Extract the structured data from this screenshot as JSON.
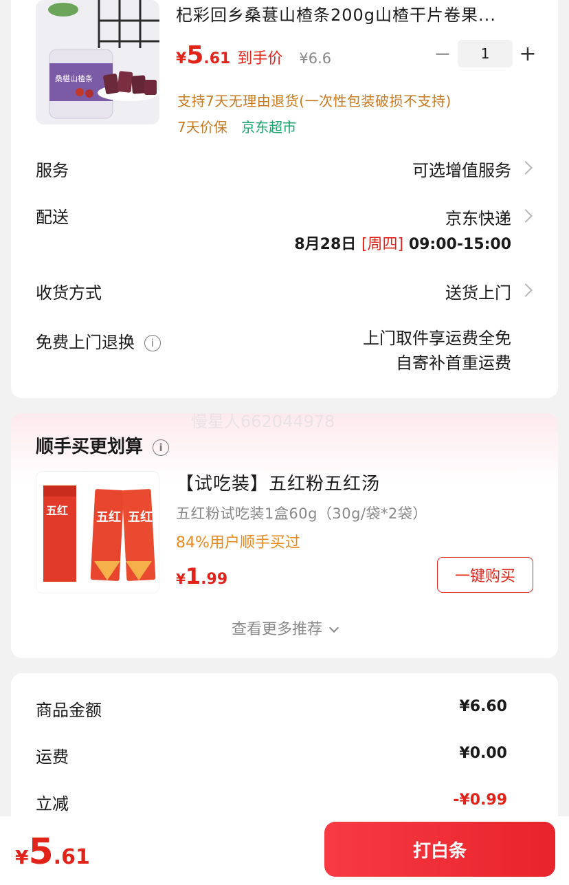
{
  "product": {
    "title": "杞彩回乡桑葚山楂条200g山楂干片卷果...",
    "price_currency": "¥",
    "price_int": "5",
    "price_dec": ".61",
    "price_tag": "到手价",
    "original_price": "¥6.6",
    "quantity": "1",
    "minus_symbol": "−",
    "plus_symbol": "+",
    "return_note": "支持7天无理由退货(一次性包装破损不支持)",
    "tag_guarantee": "7天价保",
    "tag_market": "京东超市",
    "jar_label": "桑椹山楂条"
  },
  "rows": {
    "service_label": "服务",
    "service_value": "可选增值服务",
    "delivery_label": "配送",
    "delivery_value": "京东快递",
    "delivery_date": "8月28日",
    "delivery_weekday": "[周四]",
    "delivery_time": "09:00-15:00",
    "receive_label": "收货方式",
    "receive_value": "送货上门",
    "free_return_label": "免费上门退换",
    "free_return_line1": "上门取件享运费全免",
    "free_return_line2": "自寄补首重运费",
    "info_symbol": "i"
  },
  "recommend": {
    "watermark": "慢星人66204​4978",
    "title": "顺手买更划算",
    "name": "【试吃装】五红粉五红汤",
    "spec": "五红粉试吃装1盒60g（30g/袋*2袋）",
    "bought": "84%用户顺手买过",
    "price_currency": "¥",
    "price_int": "1",
    "price_dec": ".99",
    "buy_label": "一键购买",
    "more_label": "查看更多推荐",
    "pack_text": "五红"
  },
  "summary": {
    "goods_label": "商品金额",
    "goods_value": "¥6.60",
    "shipping_label": "运费",
    "shipping_value": "¥0.00",
    "discount_label": "立减",
    "discount_value": "-¥0.99"
  },
  "bottom": {
    "total_currency": "¥",
    "total_int": "5",
    "total_dec": ".61",
    "pay_label": "打白条"
  },
  "colors": {
    "accent_red": "#e2231a",
    "note_orange": "#c8781e",
    "market_green": "#1aa36a"
  }
}
